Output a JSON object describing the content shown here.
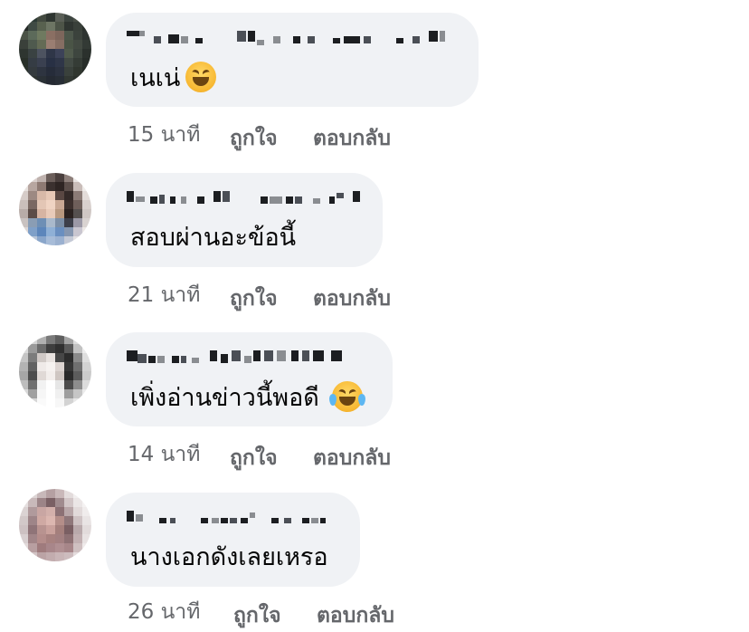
{
  "comments": [
    {
      "text": "เนเน่",
      "emoji": "grinning-squinting-face",
      "time": "15 นาที",
      "like_label": "ถูกใจ",
      "reply_label": "ตอบกลับ"
    },
    {
      "text": "สอบผ่านอะข้อนี้",
      "emoji": "",
      "time": "21 นาที",
      "like_label": "ถูกใจ",
      "reply_label": "ตอบกลับ"
    },
    {
      "text": "เพิ่งอ่านข่าวนี้พอดี",
      "emoji": "face-with-tears-of-joy",
      "time": "14 นาที",
      "like_label": "ถูกใจ",
      "reply_label": "ตอบกลับ"
    },
    {
      "text": "นางเอกดังเลยเหรอ",
      "emoji": "",
      "time": "26 นาที",
      "like_label": "ถูกใจ",
      "reply_label": "ตอบกลับ"
    }
  ],
  "colors": {
    "bubble": "#f0f2f5",
    "meta_text": "#65676b",
    "text": "#050505"
  }
}
